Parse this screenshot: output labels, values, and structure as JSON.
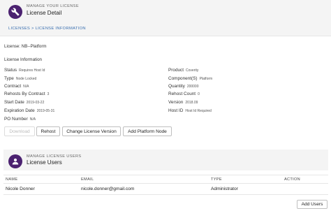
{
  "header": {
    "kicker": "MANAGE YOUR LICENSE",
    "title": "License Detail",
    "icon": "wrench-icon",
    "accent_color": "#4b2170"
  },
  "breadcrumb": {
    "items": [
      "LICENSES",
      "LICENSE INFORMATION"
    ],
    "separator": ">"
  },
  "license": {
    "name_label": "License:",
    "name": "NB--Platform",
    "section_title": "License Information"
  },
  "details": {
    "left": [
      {
        "label": "Status",
        "value": "Requires Host Id"
      },
      {
        "label": "Type",
        "value": "Node Locked"
      },
      {
        "label": "Contract",
        "value": "N/A"
      },
      {
        "label": "Rehosts By Contract",
        "value": "3"
      },
      {
        "label": "Start Date",
        "value": "2019-03-22"
      },
      {
        "label": "Expiration Date",
        "value": "2019-05-31"
      },
      {
        "label": "PO Number",
        "value": "N/A"
      }
    ],
    "right": [
      {
        "label": "Product",
        "value": "Coverity"
      },
      {
        "label": "Component(S)",
        "value": "Platform"
      },
      {
        "label": "Quantity",
        "value": "200000"
      },
      {
        "label": "Rehost Count",
        "value": "0"
      },
      {
        "label": "Version",
        "value": "2018.09"
      },
      {
        "label": "Host ID",
        "value": "Host Id Required"
      }
    ]
  },
  "actions": {
    "download": "Download",
    "rehost": "Rehost",
    "change_version": "Change License Version",
    "add_platform_node": "Add Platform Node"
  },
  "users_panel": {
    "kicker": "MANAGE LICENSE USERS",
    "title": "License Users",
    "icon": "user-icon"
  },
  "users_table": {
    "columns": [
      "NAME",
      "EMAIL",
      "TYPE",
      "ACTION"
    ],
    "rows": [
      {
        "name": "Nicole Donner",
        "email": "nicole.donner@gmail.com",
        "type": "Administrator",
        "action": ""
      }
    ]
  },
  "add_users_button": "Add Users"
}
